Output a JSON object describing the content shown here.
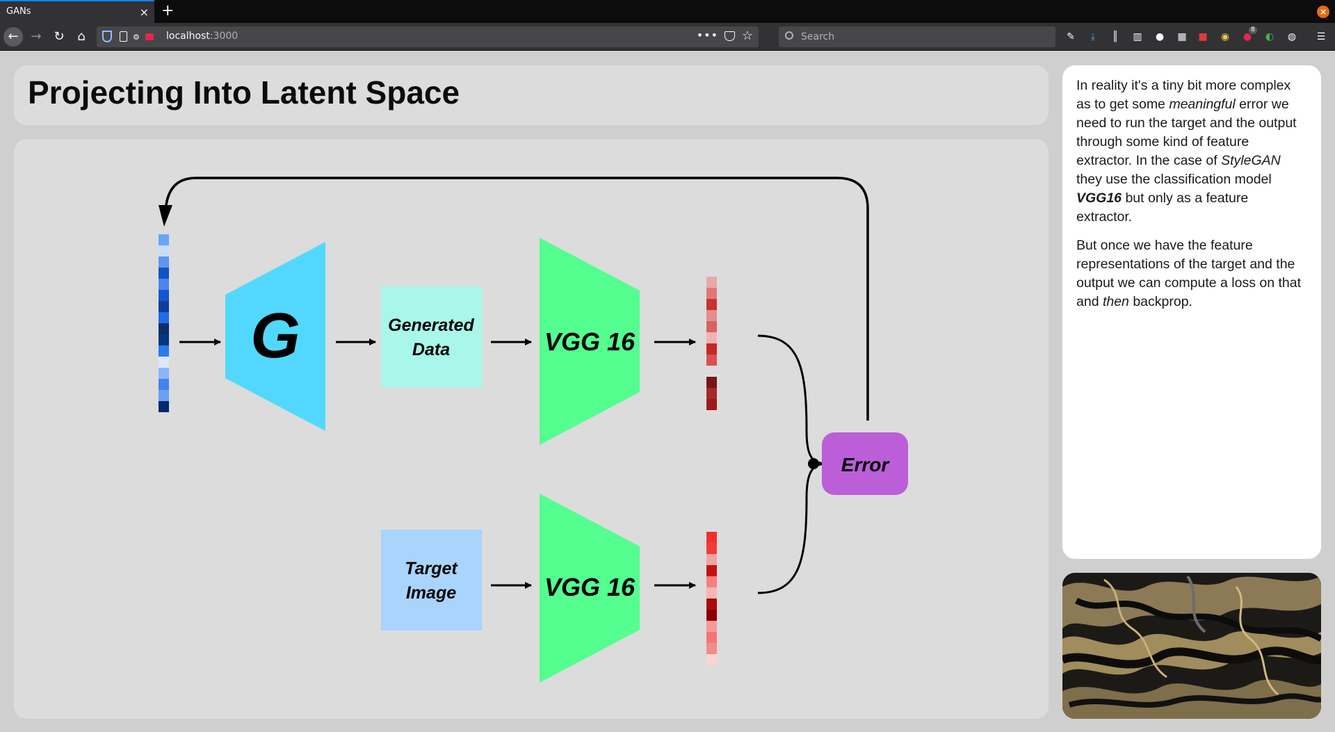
{
  "browser": {
    "tab_title": "GANs",
    "tab_close": "×",
    "new_tab": "+",
    "window_close": "×",
    "url_host": "localhost",
    "url_port": ":3000",
    "search_placeholder": "Search",
    "extension_badge": "8",
    "icons": [
      "back-arrow-icon",
      "forward-arrow-icon",
      "reload-icon",
      "home-icon",
      "shield-icon",
      "page-icon",
      "permissions-icon",
      "camera-icon",
      "more-icon",
      "pocket-icon",
      "star-icon",
      "search-icon",
      "tools-icon",
      "download-icon",
      "library-icon",
      "sidebar-icon",
      "account-icon",
      "extension-icon",
      "menu-icon"
    ]
  },
  "slide": {
    "title": "Projecting Into Latent Space",
    "diagram": {
      "generator_label": "G",
      "generated_line1": "Generated",
      "generated_line2": "Data",
      "target_line1": "Target",
      "target_line2": "Image",
      "vgg_top_label": "VGG 16",
      "vgg_bottom_label": "VGG 16",
      "error_label": "Error",
      "colors": {
        "generator": "#52d8ff",
        "generated_box": "#a8f7ea",
        "target_box": "#a9d4fc",
        "vgg": "#54fe8f",
        "error": "#bb5ed8",
        "latent_blue_dark": "#003780",
        "feature_red": "#c71e1e"
      }
    },
    "notes": {
      "p1_a": "In reality it's a tiny bit more complex as to get some ",
      "p1_em1": "meaningful",
      "p1_b": " error we need to run the target and the output through some kind of feature extractor. In the case of ",
      "p1_em2": "StyleGAN",
      "p1_c": " they use the classification model ",
      "p1_strong": "VGG16",
      "p1_d": " but only as a feature extractor.",
      "p2_a": "But once we have the feature representations of the target and the output we can compute a loss on that and ",
      "p2_em": "then",
      "p2_b": " backprop."
    }
  }
}
